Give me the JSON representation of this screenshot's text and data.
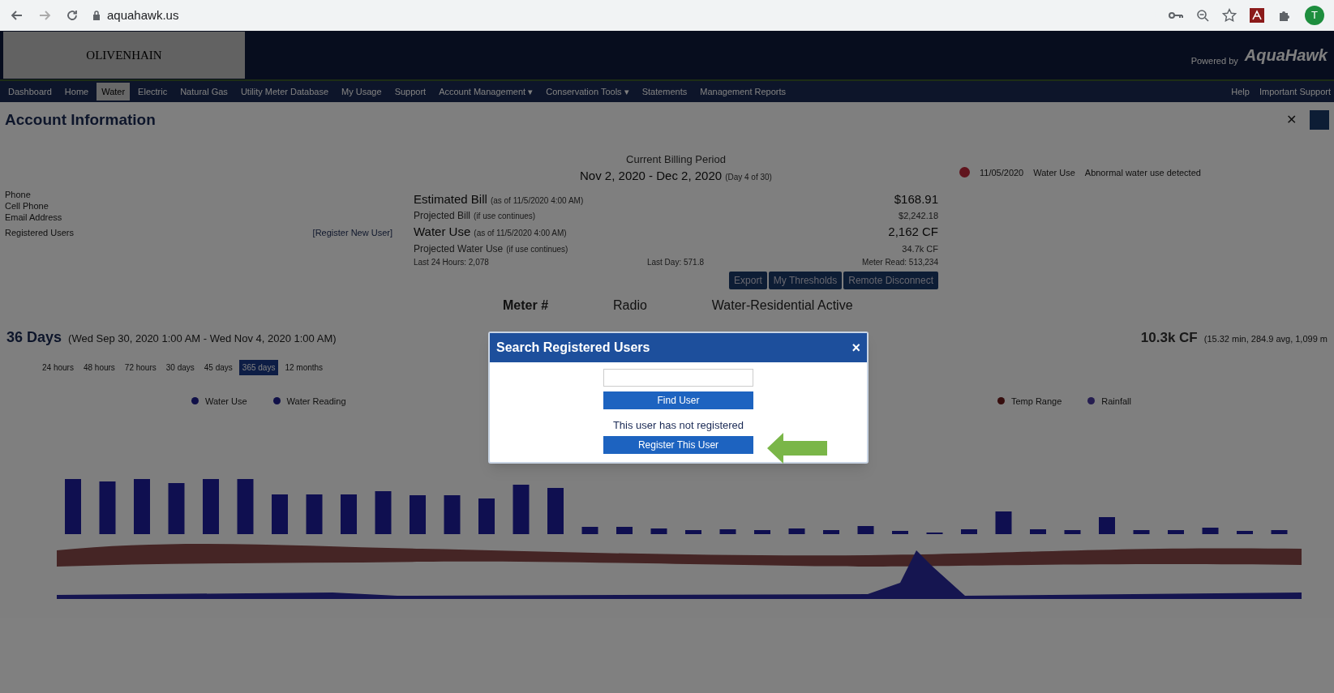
{
  "browser": {
    "url": "aquahawk.us",
    "profile_initial": "T"
  },
  "header": {
    "logo": "OLIVENHAIN",
    "powered_by": "Powered by",
    "brand": "AquaHawk"
  },
  "nav": {
    "items": [
      {
        "label": "Dashboard",
        "selected": false
      },
      {
        "label": "Home",
        "selected": false
      },
      {
        "label": "Water",
        "selected": true
      },
      {
        "label": "Electric",
        "selected": false
      },
      {
        "label": "Natural Gas",
        "selected": false
      },
      {
        "label": "Utility Meter Database",
        "selected": false
      },
      {
        "label": "My Usage",
        "selected": false
      },
      {
        "label": "Support",
        "selected": false
      },
      {
        "label": "Account Management ▾",
        "selected": false
      },
      {
        "label": "Conservation Tools ▾",
        "selected": false
      },
      {
        "label": "Statements",
        "selected": false
      },
      {
        "label": "Management Reports",
        "selected": false
      }
    ],
    "right_items": [
      "Help",
      "Important Support"
    ]
  },
  "account": {
    "title": "Account Information",
    "close_icon": "✕",
    "fields": [
      "Phone",
      "Cell Phone",
      "Email Address"
    ],
    "registered_label": "Registered Users",
    "register_link": "[Register New User]"
  },
  "billing": {
    "period_label": "Current Billing Period",
    "period": "Nov 2, 2020 - Dec 2, 2020",
    "period_day": "(Day 4 of 30)",
    "rows": [
      {
        "label": "Estimated Bill",
        "note": "(as of 11/5/2020 4:00 AM)",
        "value": "$168.91",
        "major": true
      },
      {
        "label": "Projected Bill",
        "note": "(if use continues)",
        "value": "$2,242.18",
        "major": false
      },
      {
        "label": "Water Use",
        "note": "(as of 11/5/2020 4:00 AM)",
        "value": "2,162 CF",
        "major": true
      },
      {
        "label": "Projected Water Use",
        "note": "(if use continues)",
        "value": "34.7k CF",
        "major": false
      }
    ],
    "last_24": "Last 24 Hours: 2,078",
    "last_day": "Last Day: 571.8",
    "meter_read": "Meter Read: 513,234",
    "buttons": [
      "Export",
      "My Thresholds",
      "Remote Disconnect"
    ]
  },
  "alert": {
    "date": "11/05/2020",
    "type": "Water Use",
    "message": "Abnormal water use detected"
  },
  "meter": {
    "label": "Meter #",
    "type": "Radio",
    "service": "Water-Residential Active"
  },
  "period": {
    "title": "36 Days",
    "range": "(Wed Sep 30, 2020 1:00 AM - Wed Nov 4, 2020 1:00 AM)",
    "total": "10.3k CF",
    "stats": "(15.32 min, 284.9 avg, 1,099 m"
  },
  "ranges": [
    {
      "label": "24 hours",
      "selected": false
    },
    {
      "label": "48 hours",
      "selected": false
    },
    {
      "label": "72 hours",
      "selected": false
    },
    {
      "label": "30 days",
      "selected": false
    },
    {
      "label": "45 days",
      "selected": false
    },
    {
      "label": "365 days",
      "selected": true
    },
    {
      "label": "12 months",
      "selected": false
    }
  ],
  "legend": [
    {
      "label": "Water Use",
      "color": "#101048"
    },
    {
      "label": "Water Reading",
      "color": "#101048"
    },
    {
      "label": "Temp Range",
      "color": "#360d0d"
    },
    {
      "label": "Rainfall",
      "color": "#251d50"
    }
  ],
  "modal": {
    "title": "Search Registered Users",
    "close": "×",
    "find_button": "Find User",
    "message": "This user has not registered",
    "register_button": "Register This User"
  }
}
